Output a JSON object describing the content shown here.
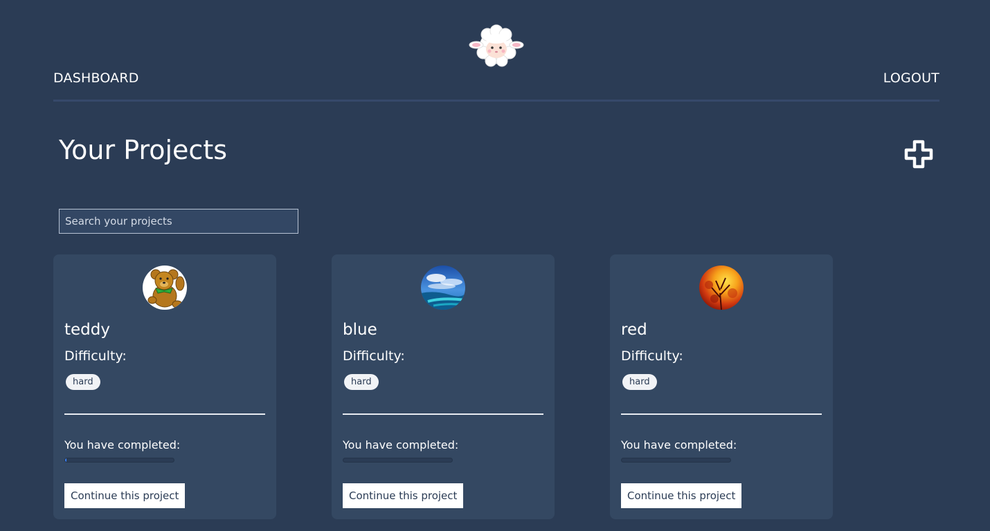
{
  "nav": {
    "dashboard_label": "DASHBOARD",
    "logout_label": "LOGOUT"
  },
  "page": {
    "title": "Your Projects"
  },
  "search": {
    "placeholder": "Search your projects",
    "value": ""
  },
  "projects": [
    {
      "name": "teddy",
      "difficulty_label": "Difficulty:",
      "difficulty": "hard",
      "completed_label": "You have completed:",
      "progress": 0.01,
      "button_label": "Continue this project",
      "image": "teddy-bear-image"
    },
    {
      "name": "blue",
      "difficulty_label": "Difficulty:",
      "difficulty": "hard",
      "completed_label": "You have completed:",
      "progress": 0,
      "button_label": "Continue this project",
      "image": "blue-ocean-image"
    },
    {
      "name": "red",
      "difficulty_label": "Difficulty:",
      "difficulty": "hard",
      "completed_label": "You have completed:",
      "progress": 0,
      "button_label": "Continue this project",
      "image": "red-autumn-tree-image"
    }
  ],
  "colors": {
    "background": "#2b3c55",
    "card": "#344862",
    "accent": "#3b82f6",
    "text": "#ffffff"
  },
  "icons": {
    "logo": "sheep-logo-icon",
    "add": "plus-icon"
  }
}
